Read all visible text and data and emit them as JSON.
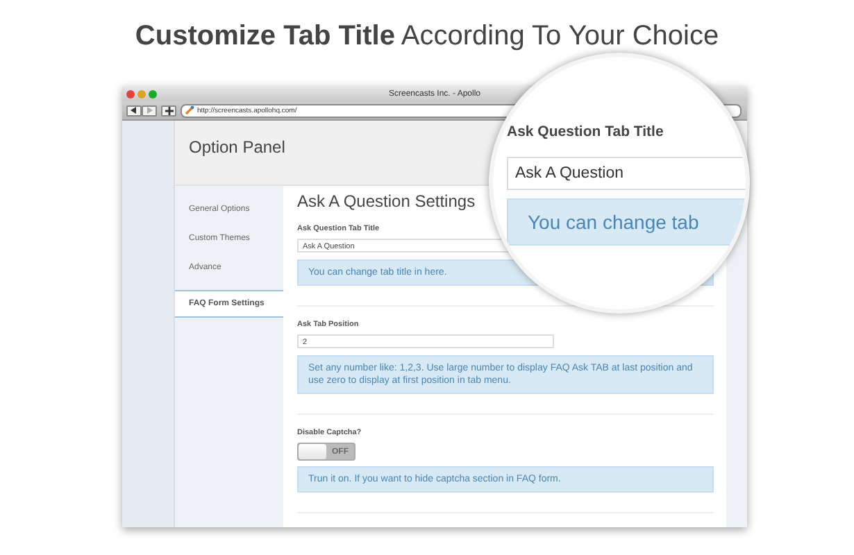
{
  "banner": {
    "title": "**Customize Tab Title** According To Your Choice"
  },
  "browser": {
    "title": "Screencasts Inc. - Apollo",
    "url": "http://screencasts.apollohq.com/"
  },
  "panel": {
    "title": "Option Panel"
  },
  "sidebar": {
    "items": [
      {
        "label": "General Options",
        "selected": false
      },
      {
        "label": "Custom Themes",
        "selected": false
      },
      {
        "label": "Advance",
        "selected": false
      },
      {
        "label": "FAQ Form Settings",
        "selected": true
      }
    ]
  },
  "settings": {
    "title": "Ask A Question Settings",
    "sections": [
      {
        "kind": "text",
        "label": "Ask Question Tab Title",
        "value": "Ask A Question",
        "help": "You can change tab title in here."
      },
      {
        "kind": "text",
        "label": "Ask Tab Position",
        "value": "2",
        "help": "Set any number like: 1,2,3. Use large number to display FAQ Ask TAB at last position and use zero to display at first position in tab menu."
      },
      {
        "kind": "toggle",
        "label": "Disable Captcha?",
        "on": false,
        "toggle_label": "OFF",
        "help": "Trun it on. If you want to hide captcha section in FAQ form."
      }
    ]
  },
  "magnifier": {
    "label": "Ask Question Tab Title",
    "value": "Ask A Question",
    "help": "You can change tab"
  }
}
